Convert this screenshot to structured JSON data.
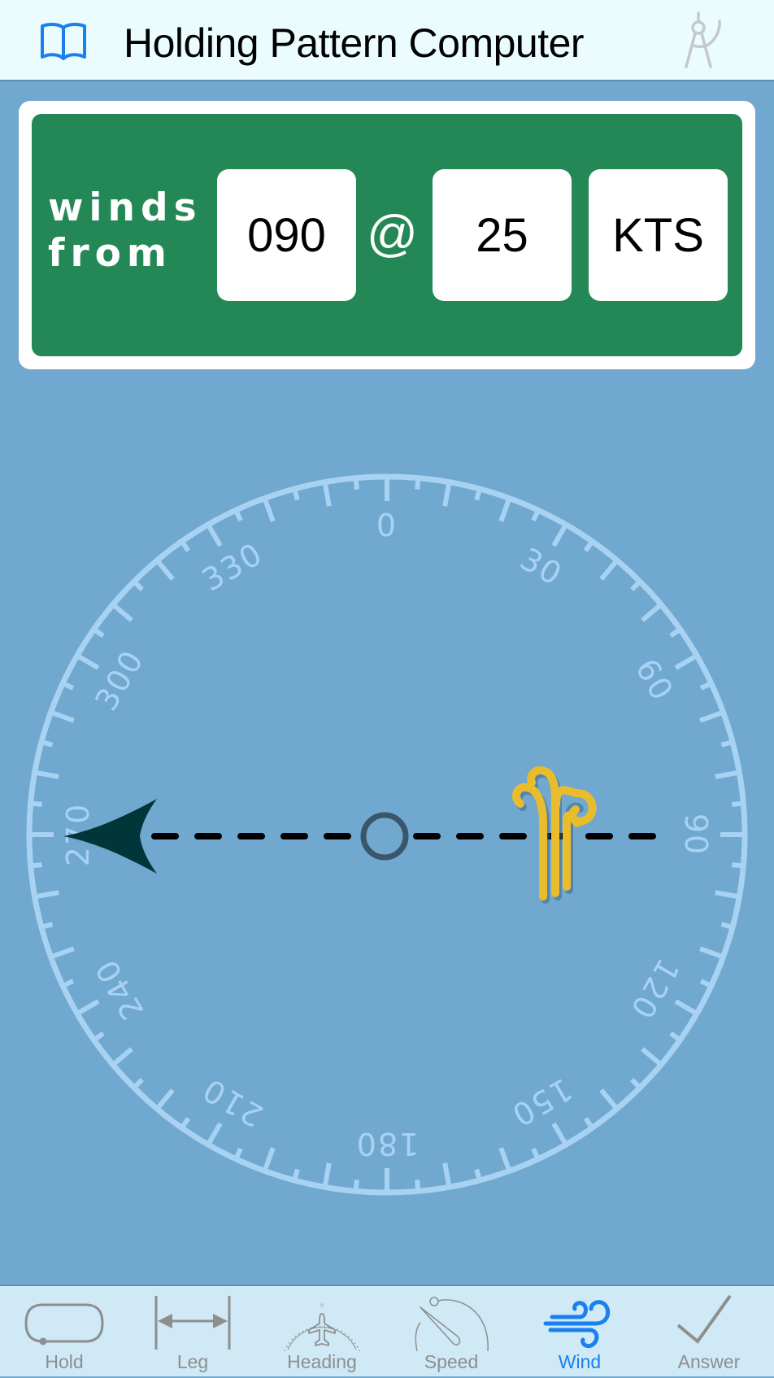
{
  "header": {
    "title": "Holding Pattern Computer",
    "left_icon": "book-icon",
    "right_icon": "drafting-compass-icon"
  },
  "wind_input": {
    "label_line1": "winds",
    "label_line2": "from",
    "direction": "090",
    "at_symbol": "@",
    "speed": "25",
    "units": "KTS"
  },
  "compass": {
    "labels": [
      "0",
      "30",
      "60",
      "90",
      "120",
      "150",
      "180",
      "210",
      "240",
      "270",
      "300",
      "330"
    ],
    "wind_direction_deg": 90,
    "arrow_heading_deg": 270,
    "wind_icon": "wind-swirl-icon",
    "colors": {
      "ring": "#a8d2f2",
      "arrow": "#00363a",
      "wind_icon": "#e8bc2c",
      "center_circle": "#3a566b"
    }
  },
  "tabs": [
    {
      "label": "Hold",
      "icon": "holding-pattern-icon",
      "active": false
    },
    {
      "label": "Leg",
      "icon": "leg-length-icon",
      "active": false
    },
    {
      "label": "Heading",
      "icon": "heading-indicator-icon",
      "active": false
    },
    {
      "label": "Speed",
      "icon": "airspeed-gauge-icon",
      "active": false
    },
    {
      "label": "Wind",
      "icon": "wind-icon",
      "active": true
    },
    {
      "label": "Answer",
      "icon": "checkmark-icon",
      "active": false
    }
  ],
  "colors": {
    "background": "#71a8d0",
    "header_bg": "#eafcfe",
    "card_green": "#238855",
    "tab_active": "#1a80f0",
    "tab_inactive": "#8e8e8e"
  }
}
